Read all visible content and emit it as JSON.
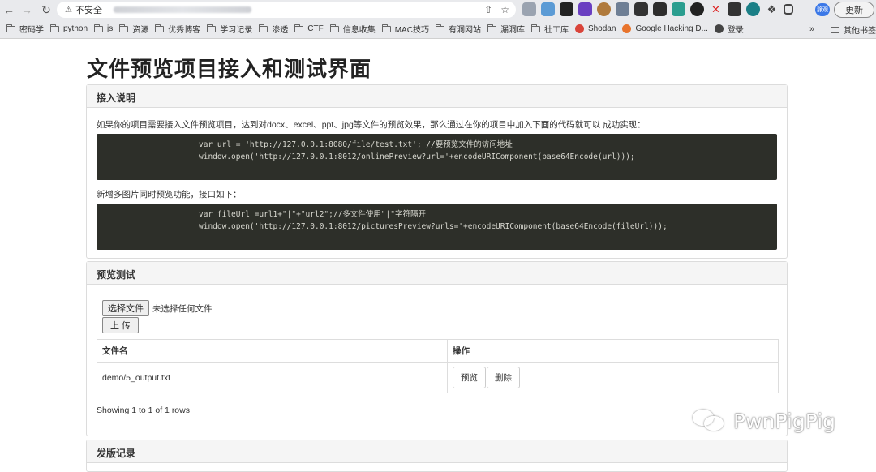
{
  "browser": {
    "security_label": "不安全",
    "update_label": "更新",
    "avatar_label": "静观",
    "bookmarks": [
      {
        "label": "密码学",
        "kind": "folder"
      },
      {
        "label": "python",
        "kind": "folder"
      },
      {
        "label": "js",
        "kind": "folder"
      },
      {
        "label": "资源",
        "kind": "folder"
      },
      {
        "label": "优秀博客",
        "kind": "folder"
      },
      {
        "label": "学习记录",
        "kind": "folder"
      },
      {
        "label": "渗透",
        "kind": "folder"
      },
      {
        "label": "CTF",
        "kind": "folder"
      },
      {
        "label": "信息收集",
        "kind": "folder"
      },
      {
        "label": "MAC技巧",
        "kind": "folder"
      },
      {
        "label": "有洞网站",
        "kind": "folder"
      },
      {
        "label": "漏洞库",
        "kind": "folder"
      },
      {
        "label": "社工库",
        "kind": "folder"
      },
      {
        "label": "Shodan",
        "kind": "site",
        "color": "#d9443a"
      },
      {
        "label": "Google Hacking D...",
        "kind": "site",
        "color": "#e8742c"
      },
      {
        "label": "登录",
        "kind": "site",
        "color": "#444444"
      }
    ],
    "more_label": "»",
    "other_bookmarks_label": "其他书签"
  },
  "page": {
    "title": "文件预览项目接入和测试界面",
    "intro_panel": {
      "heading": "接入说明",
      "text1": "如果你的项目需要接入文件预览项目，达到对docx、excel、ppt、jpg等文件的预览效果，那么通过在你的项目中加入下面的代码就可以 成功实现：",
      "code1_line1": "var url = 'http://127.0.0.1:8080/file/test.txt'; //要预览文件的访问地址",
      "code1_line2": "window.open('http://127.0.0.1:8012/onlinePreview?url='+encodeURIComponent(base64Encode(url)));",
      "text2": "新增多图片同时预览功能，接口如下：",
      "code2_line1": "var fileUrl =url1+\"|\"+\"url2\";//多文件使用\"|\"字符隔开",
      "code2_line2": "window.open('http://127.0.0.1:8012/picturesPreview?urls='+encodeURIComponent(base64Encode(fileUrl)));"
    },
    "test_panel": {
      "heading": "预览测试",
      "choose_file_label": "选择文件",
      "file_status": "未选择任何文件",
      "upload_label": "上 传",
      "table": {
        "headers": [
          "文件名",
          "操作"
        ],
        "rows": [
          {
            "filename": "demo/5_output.txt",
            "preview_label": "预览",
            "delete_label": "删除"
          }
        ]
      },
      "pagination_info": "Showing 1 to 1 of 1 rows"
    },
    "release_panel": {
      "heading": "发版记录"
    },
    "watermark": "PwnPigPig"
  }
}
